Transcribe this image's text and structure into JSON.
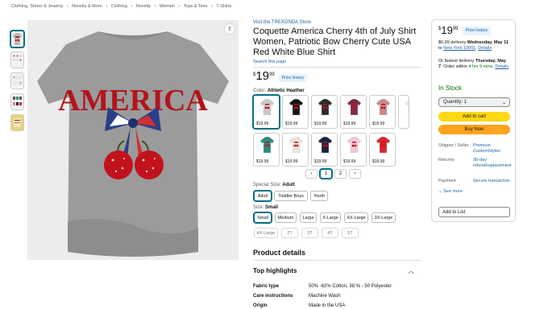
{
  "breadcrumb": [
    "Clothing, Shoes & Jewelry",
    "›",
    "Novelty & More",
    "›",
    "Clothing",
    "›",
    "Novelty",
    "›",
    "Women",
    "›",
    "Tops & Tees",
    "›",
    "T-Shirts"
  ],
  "product": {
    "store_link": "Visit the TREXONDA Store",
    "title": "Coquette America Cherry 4th of July Shirt Women, Patriotic Bow Cherry Cute USA Red White Blue Shirt",
    "search_link": "Search this page",
    "image_text": "AMERICA",
    "price": {
      "currency": "$",
      "whole": "19",
      "fraction": "99"
    },
    "price_history": "Price history"
  },
  "colors": {
    "label": "Color:",
    "selected": "Athletic Heather",
    "swatch_price": "$19.99",
    "swatches": [
      "#c9c9c9",
      "#151515",
      "#2b2b2b",
      "#7a2e45",
      "#c98a8a",
      "#dfe7ef",
      "#2e8b7a",
      "#e9e4da",
      "#1c2140",
      "#f4c6d6",
      "#d8262c"
    ]
  },
  "pager": {
    "prev": "‹",
    "page1": "1",
    "page2": "2",
    "next": "›"
  },
  "special_size": {
    "label": "Special Size:",
    "selected": "Adult",
    "options": [
      "Adult",
      "Toddler Boys",
      "Youth"
    ]
  },
  "size": {
    "label": "Size:",
    "selected": "Small",
    "options": [
      "Small",
      "Medium",
      "Large",
      "X-Large",
      "XX-Large",
      "3X-Large",
      "4X-Large",
      "2T",
      "3T",
      "4T",
      "5T"
    ]
  },
  "details": {
    "heading": "Product details",
    "highlights": "Top highlights",
    "specs": [
      {
        "k": "Fabric type",
        "v": "50% -62% Cotton, 38 % - 50 Polyester"
      },
      {
        "k": "Care instructions",
        "v": "Machine Wash"
      },
      {
        "k": "Origin",
        "v": "Made in the USA"
      }
    ]
  },
  "buybox": {
    "price": {
      "currency": "$",
      "whole": "19",
      "fraction": "99"
    },
    "price_history": "Price history",
    "delivery_pre": "$6.99 delivery",
    "delivery_date": "Wednesday, May 11",
    "delivery_to": "to",
    "location": "New York 10001",
    "details": "Details",
    "fastest_pre": "Or fastest delivery",
    "fastest_date": "Thursday, May 7",
    "order_within_pre": ". Order within",
    "order_time": "4 hrs 5 mins",
    "fastest_details": "Details",
    "stock": "In Stock",
    "qty": "Quantity: 1",
    "add_to_cart": "Add to cart",
    "buy_now": "Buy Now",
    "shipper_k": "Shipper / Seller",
    "shipper_v": "Premium CustomStyles",
    "returns_k": "Returns",
    "returns_v": "30-day refund/replacement",
    "payment_k": "Payment",
    "payment_v": "Secure transaction",
    "see_more": "See more",
    "add_to_list": "Add to List"
  },
  "colors_theme": {
    "link": "#2162a1",
    "instock": "#007600",
    "cart": "#ffd814",
    "buy": "#ffa41c",
    "selected_border": "#007185"
  }
}
